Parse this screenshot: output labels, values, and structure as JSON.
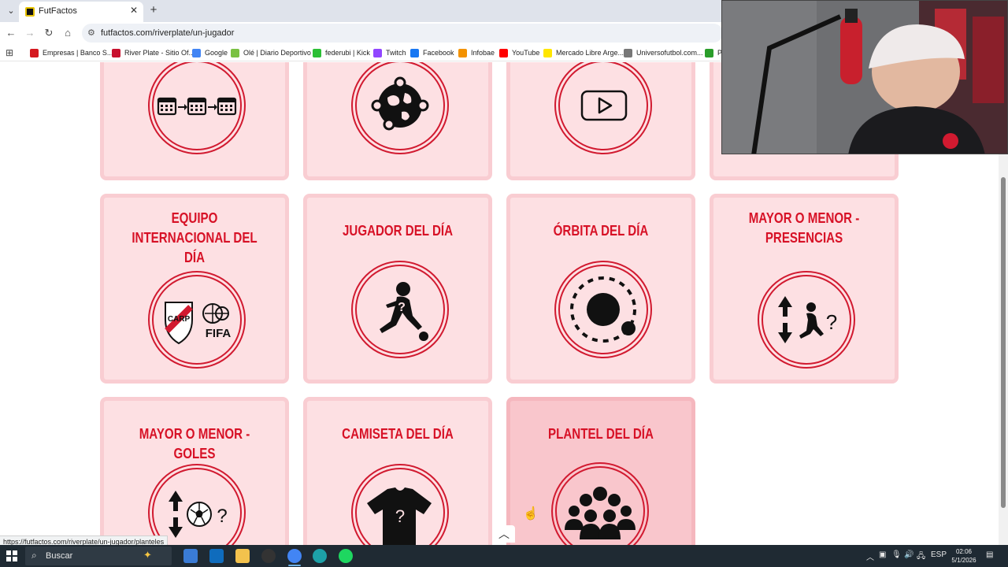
{
  "browser": {
    "tab_title": "FutFactos",
    "tab_close": "✕",
    "new_tab": "+",
    "url": "futfactos.com/riverplate/un-jugador",
    "bookmarks": [
      {
        "label": "Empresas | Banco S...",
        "color": "#d4181f"
      },
      {
        "label": "River Plate - Sitio Of...",
        "color": "#c8102e"
      },
      {
        "label": "Google",
        "color": "#4285f4"
      },
      {
        "label": "Olé | Diario Deportivo",
        "color": "#7ac143"
      },
      {
        "label": "federubi | Kick",
        "color": "#2bbf35"
      },
      {
        "label": "Twitch",
        "color": "#9146ff"
      },
      {
        "label": "Facebook",
        "color": "#1877f2"
      },
      {
        "label": "Infobae",
        "color": "#f39200"
      },
      {
        "label": "YouTube",
        "color": "#ff0000"
      },
      {
        "label": "Mercado Libre Arge...",
        "color": "#ffe600"
      },
      {
        "label": "Universofutbol.com...",
        "color": "#777777"
      },
      {
        "label": "PR",
        "color": "#2a9d2a"
      }
    ],
    "status_link": "https://futfactos.com/riverplate/un-jugador/planteles"
  },
  "cards": {
    "top": [
      {
        "icon": "calendar-sequence-icon"
      },
      {
        "icon": "globe-orbit-icon"
      },
      {
        "icon": "video-play-icon"
      },
      {
        "icon": "hidden-card-icon"
      }
    ],
    "middle": [
      {
        "title": "EQUIPO INTERNACIONAL DEL DÍA",
        "icon": "river-fifa-icon",
        "fifa_text": "FIFA"
      },
      {
        "title": "JUGADOR DEL DÍA",
        "icon": "mystery-player-icon",
        "mark": "?"
      },
      {
        "title": "ÓRBITA DEL DÍA",
        "icon": "orbit-icon"
      },
      {
        "title": "MAYOR O MENOR - PRESENCIAS",
        "icon": "higher-lower-player-icon",
        "mark": "?"
      }
    ],
    "bottom": [
      {
        "title": "MAYOR O MENOR - GOLES",
        "icon": "higher-lower-ball-icon",
        "mark": "?"
      },
      {
        "title": "CAMISETA DEL DÍA",
        "icon": "mystery-shirt-icon",
        "mark": "?"
      },
      {
        "title": "PLANTEL DEL DÍA",
        "icon": "squad-group-icon"
      }
    ]
  },
  "taskbar": {
    "search_placeholder": "Buscar",
    "language": "ESP",
    "time": "02:06",
    "date": "5/1/2026"
  },
  "colors": {
    "accent": "#d71126",
    "card_bg": "#fde0e3",
    "card_border": "#f9cdd2"
  }
}
